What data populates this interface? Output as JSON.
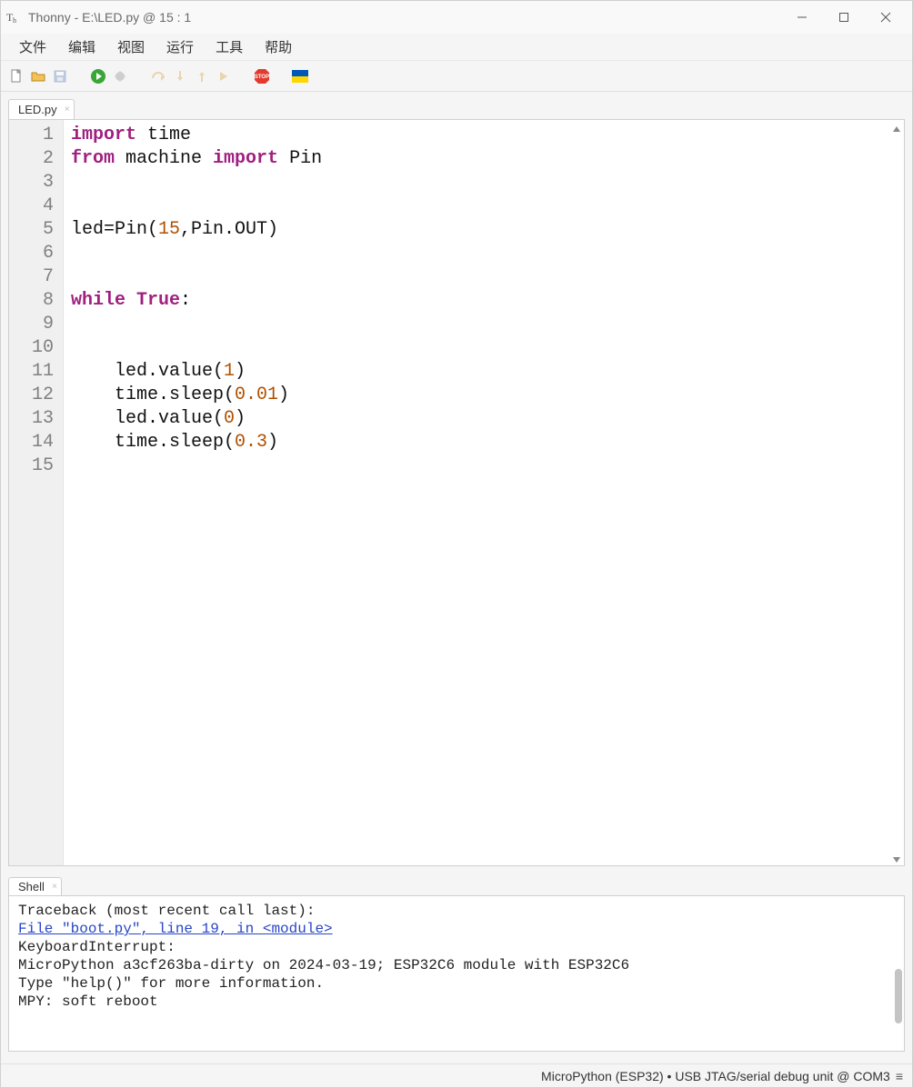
{
  "title": "Thonny  -  E:\\LED.py  @  15 : 1",
  "menu": {
    "items": [
      "文件",
      "编辑",
      "视图",
      "运行",
      "工具",
      "帮助"
    ]
  },
  "tabs": {
    "editor": "LED.py",
    "shell": "Shell"
  },
  "code": {
    "lines": [
      {
        "n": 1,
        "tokens": [
          [
            "kw",
            "import"
          ],
          [
            "",
            " time"
          ]
        ]
      },
      {
        "n": 2,
        "tokens": [
          [
            "kw",
            "from"
          ],
          [
            "",
            " machine "
          ],
          [
            "kw",
            "import"
          ],
          [
            "",
            " Pin"
          ]
        ]
      },
      {
        "n": 3,
        "tokens": [
          [
            "",
            ""
          ]
        ]
      },
      {
        "n": 4,
        "tokens": [
          [
            "",
            ""
          ]
        ]
      },
      {
        "n": 5,
        "tokens": [
          [
            "",
            "led=Pin("
          ],
          [
            "num",
            "15"
          ],
          [
            "",
            ",Pin.OUT)"
          ]
        ]
      },
      {
        "n": 6,
        "tokens": [
          [
            "",
            ""
          ]
        ]
      },
      {
        "n": 7,
        "tokens": [
          [
            "",
            ""
          ]
        ]
      },
      {
        "n": 8,
        "tokens": [
          [
            "kw",
            "while"
          ],
          [
            "",
            " "
          ],
          [
            "kw",
            "True"
          ],
          [
            "",
            ":"
          ]
        ]
      },
      {
        "n": 9,
        "tokens": [
          [
            "",
            ""
          ]
        ]
      },
      {
        "n": 10,
        "tokens": [
          [
            "",
            ""
          ]
        ]
      },
      {
        "n": 11,
        "tokens": [
          [
            "",
            "    led.value("
          ],
          [
            "num",
            "1"
          ],
          [
            "",
            ")"
          ]
        ]
      },
      {
        "n": 12,
        "tokens": [
          [
            "",
            "    time.sleep("
          ],
          [
            "num",
            "0.01"
          ],
          [
            "",
            ")"
          ]
        ]
      },
      {
        "n": 13,
        "tokens": [
          [
            "",
            "    led.value("
          ],
          [
            "num",
            "0"
          ],
          [
            "",
            ")"
          ]
        ]
      },
      {
        "n": 14,
        "tokens": [
          [
            "",
            "    time.sleep("
          ],
          [
            "num",
            "0.3"
          ],
          [
            "",
            ")"
          ]
        ]
      },
      {
        "n": 15,
        "tokens": [
          [
            "",
            ""
          ]
        ]
      }
    ]
  },
  "shell": {
    "line1": "Traceback (most recent call last):",
    "link": "  File \"boot.py\", line 19, in <module>",
    "line3": "KeyboardInterrupt: ",
    "line4": "MicroPython a3cf263ba-dirty on 2024-03-19; ESP32C6 module with ESP32C6",
    "line5": "Type \"help()\" for more information.",
    "blank": "",
    "line6": "MPY: soft reboot"
  },
  "status": {
    "text": "MicroPython (ESP32)  •  USB JTAG/serial debug unit @ COM3"
  }
}
